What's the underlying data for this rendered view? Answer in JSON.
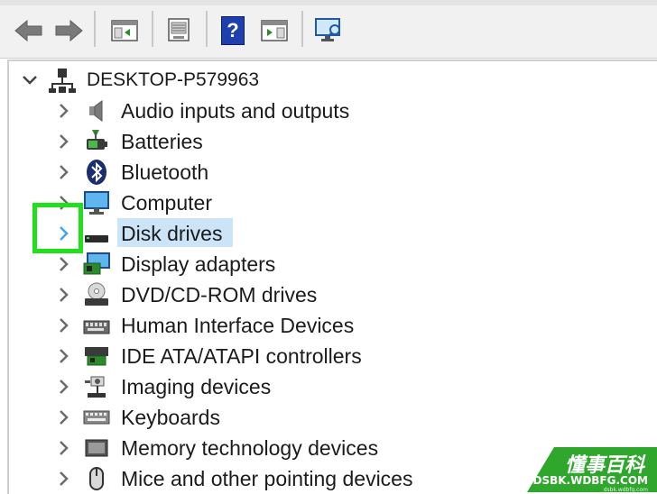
{
  "toolbar": {
    "buttons": [
      {
        "name": "back-button",
        "icon": "back-arrow-icon"
      },
      {
        "name": "forward-button",
        "icon": "forward-arrow-icon"
      },
      {
        "name": "show-hide-console-tree-button",
        "icon": "console-tree-icon"
      },
      {
        "name": "properties-button",
        "icon": "properties-icon"
      },
      {
        "name": "help-button",
        "icon": "help-icon",
        "glyph": "?"
      },
      {
        "name": "action-pane-button",
        "icon": "action-pane-icon"
      },
      {
        "name": "scan-hardware-button",
        "icon": "monitor-scan-icon"
      }
    ]
  },
  "tree": {
    "root": {
      "label": "DESKTOP-P579963",
      "expanded": true,
      "icon": "computer-network-icon"
    },
    "items": [
      {
        "label": "Audio inputs and outputs",
        "icon": "speaker-icon"
      },
      {
        "label": "Batteries",
        "icon": "battery-icon"
      },
      {
        "label": "Bluetooth",
        "icon": "bluetooth-icon"
      },
      {
        "label": "Computer",
        "icon": "computer-monitor-icon"
      },
      {
        "label": "Disk drives",
        "icon": "disk-drive-icon",
        "selected": true
      },
      {
        "label": "Display adapters",
        "icon": "display-adapter-icon"
      },
      {
        "label": "DVD/CD-ROM drives",
        "icon": "dvd-drive-icon"
      },
      {
        "label": "Human Interface Devices",
        "icon": "hid-icon"
      },
      {
        "label": "IDE ATA/ATAPI controllers",
        "icon": "ide-controller-icon"
      },
      {
        "label": "Imaging devices",
        "icon": "imaging-device-icon"
      },
      {
        "label": "Keyboards",
        "icon": "keyboard-icon"
      },
      {
        "label": "Memory technology devices",
        "icon": "memory-device-icon"
      },
      {
        "label": "Mice and other pointing devices",
        "icon": "mouse-icon"
      }
    ]
  },
  "colors": {
    "selection": "#cce4f7",
    "highlight": "#20e01c",
    "chevron": "#6b6b6b",
    "chevron_selected": "#3ea6ef",
    "watermark": "#2fa62c"
  },
  "watermark": {
    "chinese": "懂事百科",
    "url": "DSBK.WDBFG.COM",
    "url_small": "dsbk.wdbfg.com"
  }
}
